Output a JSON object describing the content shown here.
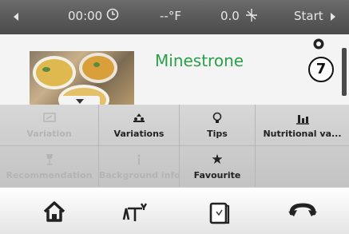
{
  "status_bar": {
    "time": "00:00",
    "temperature": "--°F",
    "speed": "0.0",
    "start_label": "Start"
  },
  "recipe": {
    "title": "Minestrone",
    "step_number": "7"
  },
  "menu": {
    "row1": [
      {
        "label": "Variation",
        "enabled": false,
        "icon": "edit-icon"
      },
      {
        "label": "Variations",
        "enabled": true,
        "icon": "variations-icon"
      },
      {
        "label": "Tips",
        "enabled": true,
        "icon": "lightbulb-icon"
      },
      {
        "label": "Nutritional va...",
        "enabled": true,
        "icon": "bar-chart-icon"
      }
    ],
    "row2": [
      {
        "label": "Recommendation",
        "enabled": false,
        "icon": "wine-glass-icon"
      },
      {
        "label": "Background info",
        "enabled": false,
        "icon": "info-icon"
      },
      {
        "label": "Favourite",
        "enabled": true,
        "icon": "star-icon"
      }
    ]
  },
  "bottom_nav": [
    {
      "name": "home",
      "icon": "home-icon"
    },
    {
      "name": "scale",
      "icon": "scale-icon"
    },
    {
      "name": "book",
      "icon": "book-icon"
    },
    {
      "name": "reverse",
      "icon": "reverse-icon"
    }
  ],
  "colors": {
    "title_green": "#2aa04a",
    "status_bar": "#555555",
    "menu_bg": "#cccccc"
  }
}
